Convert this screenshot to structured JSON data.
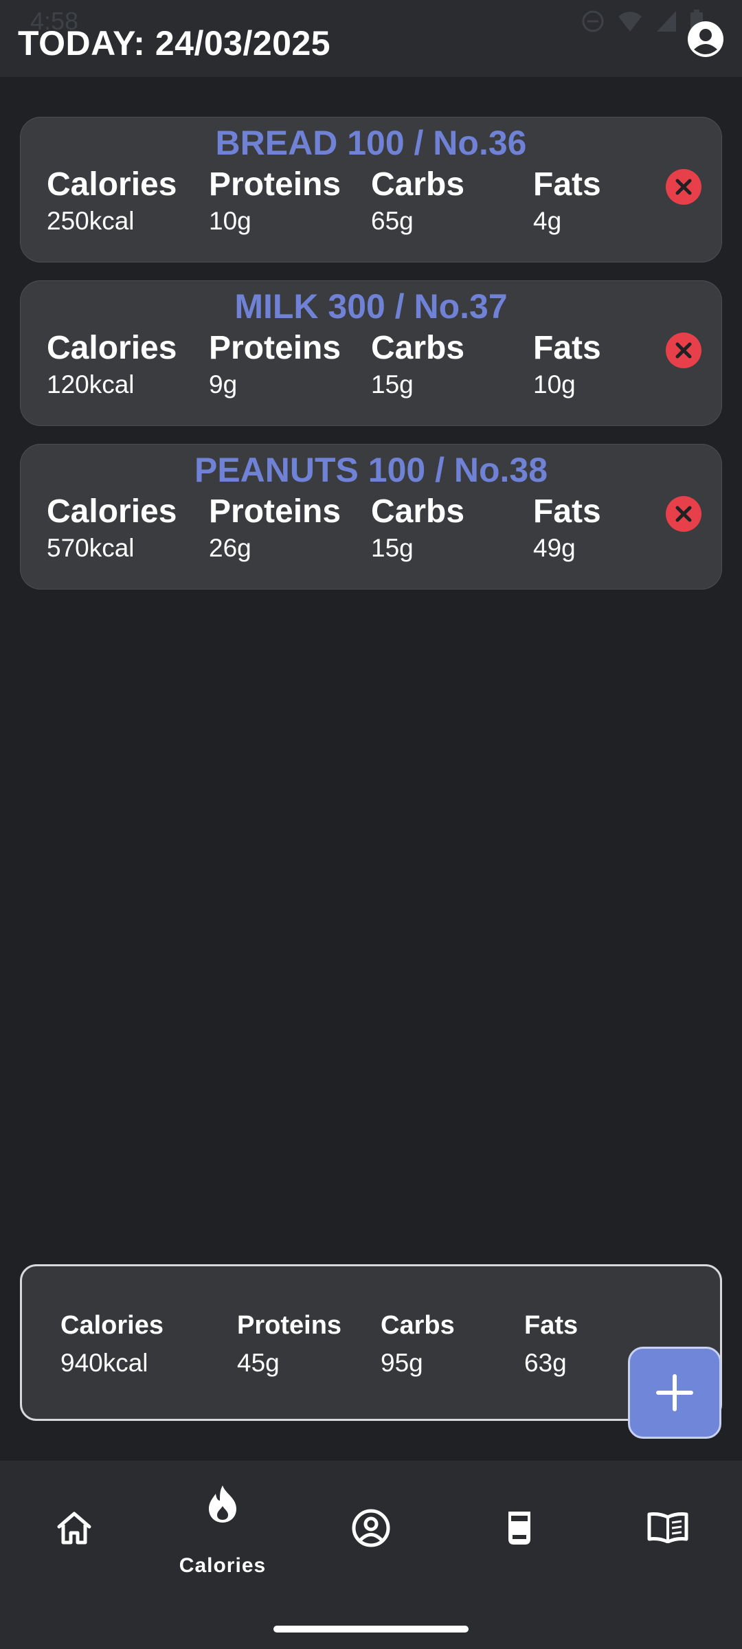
{
  "status_bar": {
    "time": "4:58"
  },
  "header": {
    "title": "TODAY: 24/03/2025",
    "profile_icon": "account-circle-icon"
  },
  "labels": {
    "calories": "Calories",
    "proteins": "Proteins",
    "carbs": "Carbs",
    "fats": "Fats"
  },
  "foods": [
    {
      "title": "BREAD 100 / No.36",
      "calories": "250kcal",
      "proteins": "10g",
      "carbs": "65g",
      "fats": "4g"
    },
    {
      "title": "MILK 300 / No.37",
      "calories": "120kcal",
      "proteins": "9g",
      "carbs": "15g",
      "fats": "10g"
    },
    {
      "title": "PEANUTS 100 / No.38",
      "calories": "570kcal",
      "proteins": "26g",
      "carbs": "15g",
      "fats": "49g"
    }
  ],
  "summary": {
    "calories": "940kcal",
    "proteins": "45g",
    "carbs": "95g",
    "fats": "63g"
  },
  "add_button_icon": "plus-icon",
  "nav": {
    "items": [
      {
        "icon": "home-icon"
      },
      {
        "icon": "flame-icon",
        "label": "Calories"
      },
      {
        "icon": "account-circle-icon"
      },
      {
        "icon": "weight-icon"
      },
      {
        "icon": "book-open-icon"
      }
    ]
  },
  "colors": {
    "accent": "#6f82d6",
    "delete": "#e8404a",
    "card": "#3a3c40",
    "background": "#1f2125"
  }
}
